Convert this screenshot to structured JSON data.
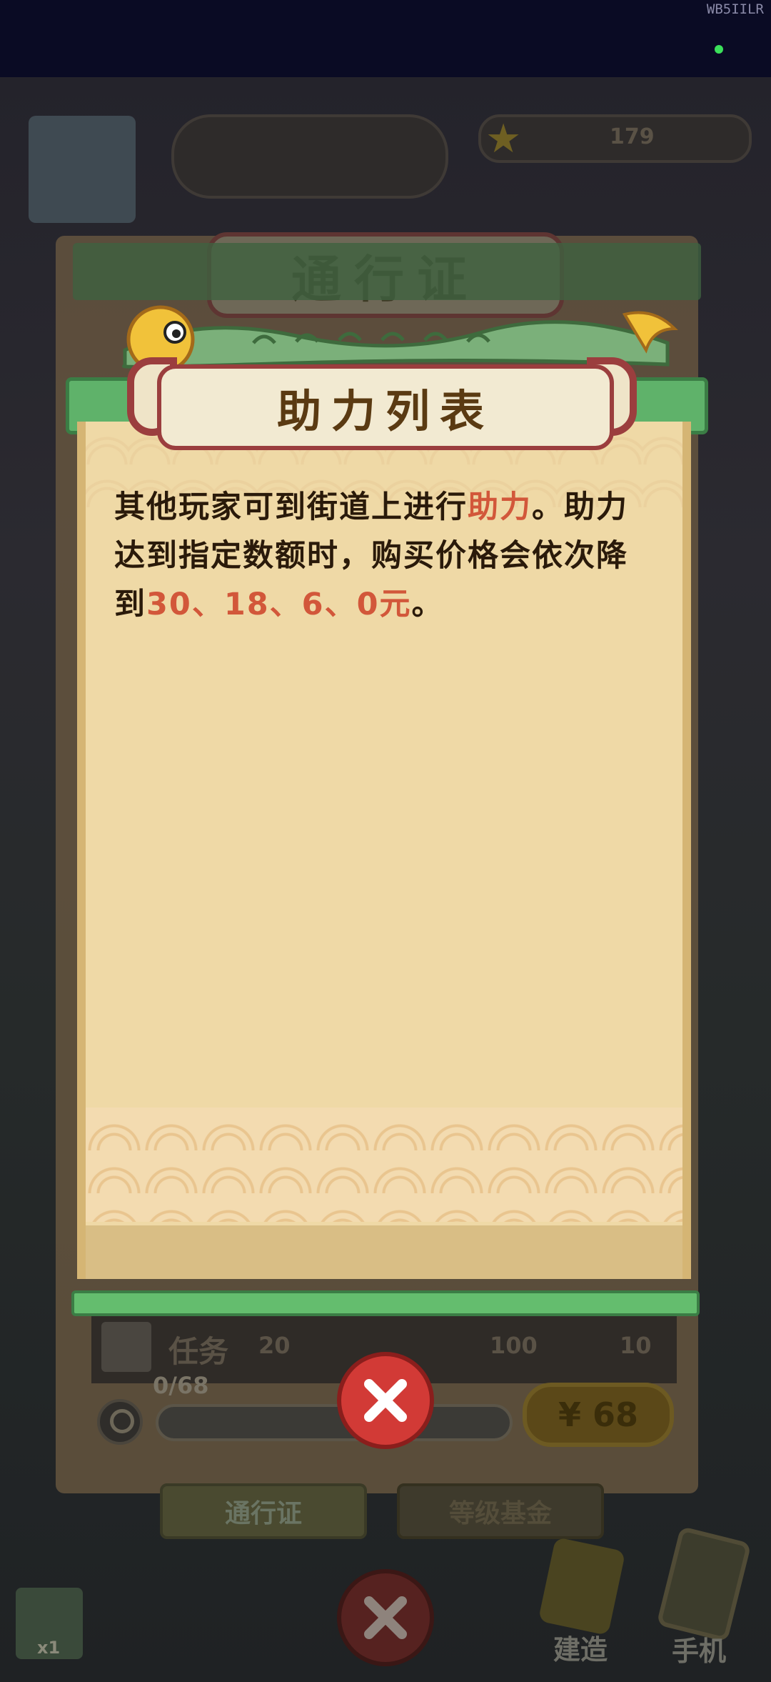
{
  "status_bar": {
    "device_tag": "WB5IILR"
  },
  "background": {
    "header_title": "通行证",
    "star_value": "179",
    "task_label": "任务",
    "task_count": "20",
    "reward_count_1": "100",
    "reward_count_2": "10",
    "progress_text": "0/68",
    "price": "¥ 68",
    "tab_pass": "通行证",
    "tab_fund": "等级基金",
    "build_label": "建造",
    "phone_label": "手机",
    "book_count": "x1"
  },
  "popup": {
    "title": "助力列表",
    "description": {
      "part1": "其他玩家可到街道上进行",
      "highlight1": "助力",
      "part2": "。助力达到指定数额时，购买价格会依次降到",
      "highlight2": "30、18、6、0元",
      "part3": "。"
    }
  },
  "colors": {
    "highlight": "#d2573a",
    "close_button": "#d23a36",
    "title_text": "#5a3a12"
  },
  "icons": {
    "close": "close-x-icon",
    "search": "search-icon",
    "star": "star-icon",
    "dragon": "dragon-icon"
  }
}
